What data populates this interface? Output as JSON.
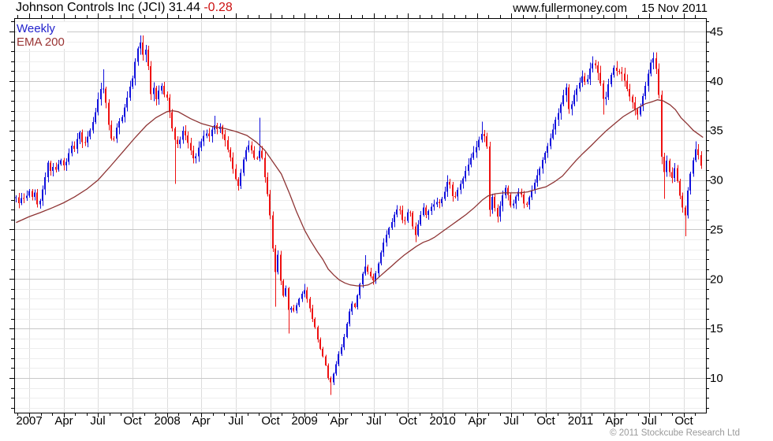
{
  "header": {
    "title": "Johnson Controls Inc (JCI) 31.44",
    "change": "-0.28",
    "website": "www.fullermoney.com",
    "date": "15 Nov 2011"
  },
  "legend": {
    "timeframe": "Weekly",
    "indicator": "EMA 200"
  },
  "footer": {
    "copyright": "© 2011 Stockcube Research Ltd"
  },
  "colors": {
    "up": "#1111dd",
    "down": "#ee1111",
    "ema": "#8e3434",
    "grid_major": "#c8c8c8",
    "grid_minor": "#ededed",
    "grid_vertical": "#dcdcdc",
    "axis": "#000000",
    "label": "#000000",
    "legend_timeframe": "#2222cc",
    "legend_indicator": "#993333",
    "change_negative": "#cc1111",
    "copyright": "#9a9a9a"
  },
  "chart_data": {
    "type": "candlestick",
    "title": "Johnson Controls Inc (JCI)",
    "interval": "weekly",
    "overlay": "EMA 200",
    "last_close": 31.44,
    "change": -0.28,
    "x_range": [
      2006.9,
      2011.885
    ],
    "ylim": [
      6.4,
      46.35
    ],
    "grid": "on",
    "y_tick_labels": [
      "10",
      "15",
      "20",
      "25",
      "30",
      "35",
      "40",
      "45"
    ],
    "y_minor_step": 1,
    "x_tick_labels": [
      "2007",
      "Apr",
      "Jul",
      "Oct",
      "2008",
      "Apr",
      "Jul",
      "Oct",
      "2009",
      "Apr",
      "Jul",
      "Oct",
      "2010",
      "Apr",
      "Jul",
      "Oct",
      "2011",
      "Apr",
      "Jul",
      "Oct"
    ],
    "weekly_close_anchors": [
      [
        2006.905,
        28.2
      ],
      [
        2006.93,
        27.6
      ],
      [
        2006.95,
        28.4
      ],
      [
        2006.97,
        28.0
      ],
      [
        2007.0,
        28.9
      ],
      [
        2007.02,
        28.2
      ],
      [
        2007.04,
        28.7
      ],
      [
        2007.06,
        27.4
      ],
      [
        2007.08,
        27.9
      ],
      [
        2007.1,
        29.2
      ],
      [
        2007.12,
        30.5
      ],
      [
        2007.14,
        32.2
      ],
      [
        2007.155,
        30.8
      ],
      [
        2007.17,
        31.5
      ],
      [
        2007.19,
        30.9
      ],
      [
        2007.21,
        31.6
      ],
      [
        2007.23,
        32.1
      ],
      [
        2007.25,
        31.4
      ],
      [
        2007.27,
        31.9
      ],
      [
        2007.29,
        32.7
      ],
      [
        2007.31,
        33.6
      ],
      [
        2007.33,
        33.1
      ],
      [
        2007.35,
        34.3
      ],
      [
        2007.37,
        35.0
      ],
      [
        2007.39,
        33.4
      ],
      [
        2007.41,
        33.9
      ],
      [
        2007.43,
        34.6
      ],
      [
        2007.45,
        35.4
      ],
      [
        2007.47,
        36.3
      ],
      [
        2007.49,
        37.4
      ],
      [
        2007.51,
        38.9
      ],
      [
        2007.53,
        39.7
      ],
      [
        2007.55,
        38.6
      ],
      [
        2007.57,
        36.4
      ],
      [
        2007.59,
        34.2
      ],
      [
        2007.61,
        33.9
      ],
      [
        2007.63,
        35.2
      ],
      [
        2007.65,
        35.8
      ],
      [
        2007.67,
        36.3
      ],
      [
        2007.69,
        37.2
      ],
      [
        2007.71,
        38.3
      ],
      [
        2007.73,
        39.4
      ],
      [
        2007.75,
        40.3
      ],
      [
        2007.77,
        42.0
      ],
      [
        2007.79,
        43.4
      ],
      [
        2007.81,
        44.0
      ],
      [
        2007.83,
        42.4
      ],
      [
        2007.85,
        43.4
      ],
      [
        2007.87,
        40.9
      ],
      [
        2007.885,
        38.5
      ],
      [
        2007.9,
        39.6
      ],
      [
        2007.92,
        38.1
      ],
      [
        2007.94,
        38.9
      ],
      [
        2007.96,
        39.6
      ],
      [
        2007.98,
        38.7
      ],
      [
        2008.0,
        38.3
      ],
      [
        2008.02,
        36.7
      ],
      [
        2008.04,
        34.9
      ],
      [
        2008.06,
        33.9
      ],
      [
        2008.08,
        33.5
      ],
      [
        2008.1,
        34.3
      ],
      [
        2008.12,
        35.2
      ],
      [
        2008.14,
        34.1
      ],
      [
        2008.16,
        33.5
      ],
      [
        2008.18,
        32.5
      ],
      [
        2008.2,
        31.9
      ],
      [
        2008.22,
        33.0
      ],
      [
        2008.24,
        33.6
      ],
      [
        2008.26,
        34.2
      ],
      [
        2008.28,
        34.8
      ],
      [
        2008.3,
        34.3
      ],
      [
        2008.32,
        35.0
      ],
      [
        2008.34,
        35.6
      ],
      [
        2008.36,
        35.1
      ],
      [
        2008.38,
        35.5
      ],
      [
        2008.4,
        34.6
      ],
      [
        2008.42,
        34.0
      ],
      [
        2008.44,
        33.1
      ],
      [
        2008.46,
        32.2
      ],
      [
        2008.48,
        31.0
      ],
      [
        2008.5,
        29.9
      ],
      [
        2008.52,
        29.4
      ],
      [
        2008.54,
        31.1
      ],
      [
        2008.56,
        32.3
      ],
      [
        2008.58,
        33.2
      ],
      [
        2008.6,
        33.6
      ],
      [
        2008.62,
        32.8
      ],
      [
        2008.64,
        31.8
      ],
      [
        2008.66,
        32.5
      ],
      [
        2008.68,
        33.4
      ],
      [
        2008.7,
        31.0
      ],
      [
        2008.72,
        29.3
      ],
      [
        2008.74,
        27.5
      ],
      [
        2008.76,
        24.8
      ],
      [
        2008.78,
        19.6
      ],
      [
        2008.8,
        23.3
      ],
      [
        2008.82,
        20.2
      ],
      [
        2008.84,
        18.1
      ],
      [
        2008.86,
        19.6
      ],
      [
        2008.875,
        16.4
      ],
      [
        2008.89,
        17.6
      ],
      [
        2008.91,
        16.6
      ],
      [
        2008.93,
        17.0
      ],
      [
        2008.95,
        17.8
      ],
      [
        2008.97,
        18.3
      ],
      [
        2009.0,
        18.9
      ],
      [
        2009.02,
        17.8
      ],
      [
        2009.04,
        16.9
      ],
      [
        2009.06,
        15.7
      ],
      [
        2009.08,
        14.8
      ],
      [
        2009.1,
        13.5
      ],
      [
        2009.12,
        12.6
      ],
      [
        2009.14,
        11.9
      ],
      [
        2009.16,
        10.7
      ],
      [
        2009.18,
        9.3
      ],
      [
        2009.2,
        9.9
      ],
      [
        2009.22,
        11.1
      ],
      [
        2009.24,
        12.1
      ],
      [
        2009.26,
        12.9
      ],
      [
        2009.28,
        13.8
      ],
      [
        2009.3,
        15.2
      ],
      [
        2009.32,
        16.6
      ],
      [
        2009.34,
        17.5
      ],
      [
        2009.36,
        17.0
      ],
      [
        2009.38,
        18.3
      ],
      [
        2009.4,
        19.4
      ],
      [
        2009.42,
        20.5
      ],
      [
        2009.44,
        21.3
      ],
      [
        2009.46,
        20.7
      ],
      [
        2009.48,
        20.1
      ],
      [
        2009.5,
        19.7
      ],
      [
        2009.52,
        20.9
      ],
      [
        2009.54,
        21.9
      ],
      [
        2009.56,
        23.1
      ],
      [
        2009.58,
        24.1
      ],
      [
        2009.6,
        24.7
      ],
      [
        2009.62,
        25.4
      ],
      [
        2009.64,
        26.1
      ],
      [
        2009.66,
        26.9
      ],
      [
        2009.68,
        27.3
      ],
      [
        2009.7,
        26.3
      ],
      [
        2009.72,
        25.5
      ],
      [
        2009.74,
        26.6
      ],
      [
        2009.76,
        27.1
      ],
      [
        2009.78,
        25.6
      ],
      [
        2009.8,
        24.3
      ],
      [
        2009.82,
        25.4
      ],
      [
        2009.84,
        26.5
      ],
      [
        2009.86,
        27.2
      ],
      [
        2009.88,
        26.5
      ],
      [
        2009.9,
        26.9
      ],
      [
        2009.92,
        27.3
      ],
      [
        2009.94,
        27.6
      ],
      [
        2009.96,
        27.9
      ],
      [
        2009.98,
        27.7
      ],
      [
        2010.0,
        28.2
      ],
      [
        2010.02,
        29.1
      ],
      [
        2010.04,
        30.1
      ],
      [
        2010.06,
        29.2
      ],
      [
        2010.08,
        27.9
      ],
      [
        2010.1,
        28.8
      ],
      [
        2010.12,
        29.3
      ],
      [
        2010.14,
        29.9
      ],
      [
        2010.16,
        30.6
      ],
      [
        2010.18,
        31.3
      ],
      [
        2010.2,
        32.1
      ],
      [
        2010.22,
        32.7
      ],
      [
        2010.24,
        33.1
      ],
      [
        2010.26,
        33.9
      ],
      [
        2010.28,
        34.8
      ],
      [
        2010.3,
        34.4
      ],
      [
        2010.32,
        33.9
      ],
      [
        2010.34,
        26.9
      ],
      [
        2010.36,
        28.3
      ],
      [
        2010.38,
        27.2
      ],
      [
        2010.4,
        26.3
      ],
      [
        2010.42,
        27.5
      ],
      [
        2010.44,
        28.7
      ],
      [
        2010.46,
        29.3
      ],
      [
        2010.48,
        28.2
      ],
      [
        2010.5,
        27.1
      ],
      [
        2010.52,
        27.9
      ],
      [
        2010.54,
        28.5
      ],
      [
        2010.56,
        29.0
      ],
      [
        2010.58,
        28.1
      ],
      [
        2010.6,
        27.1
      ],
      [
        2010.62,
        27.9
      ],
      [
        2010.64,
        28.6
      ],
      [
        2010.66,
        29.4
      ],
      [
        2010.68,
        30.3
      ],
      [
        2010.7,
        31.0
      ],
      [
        2010.72,
        31.8
      ],
      [
        2010.74,
        32.6
      ],
      [
        2010.76,
        33.3
      ],
      [
        2010.78,
        34.1
      ],
      [
        2010.8,
        35.1
      ],
      [
        2010.82,
        36.0
      ],
      [
        2010.84,
        36.8
      ],
      [
        2010.86,
        37.7
      ],
      [
        2010.88,
        38.6
      ],
      [
        2010.9,
        39.4
      ],
      [
        2010.92,
        36.6
      ],
      [
        2010.94,
        37.9
      ],
      [
        2010.96,
        38.9
      ],
      [
        2010.98,
        39.5
      ],
      [
        2011.0,
        40.1
      ],
      [
        2011.02,
        40.6
      ],
      [
        2011.04,
        39.5
      ],
      [
        2011.06,
        40.9
      ],
      [
        2011.08,
        41.6
      ],
      [
        2011.1,
        42.0
      ],
      [
        2011.12,
        41.1
      ],
      [
        2011.14,
        40.2
      ],
      [
        2011.16,
        38.7
      ],
      [
        2011.175,
        37.4
      ],
      [
        2011.19,
        38.9
      ],
      [
        2011.21,
        40.1
      ],
      [
        2011.23,
        40.9
      ],
      [
        2011.25,
        41.5
      ],
      [
        2011.27,
        40.7
      ],
      [
        2011.29,
        41.2
      ],
      [
        2011.31,
        40.4
      ],
      [
        2011.33,
        39.5
      ],
      [
        2011.35,
        38.7
      ],
      [
        2011.37,
        38.1
      ],
      [
        2011.39,
        37.4
      ],
      [
        2011.41,
        36.5
      ],
      [
        2011.43,
        37.2
      ],
      [
        2011.45,
        38.3
      ],
      [
        2011.47,
        39.3
      ],
      [
        2011.49,
        40.6
      ],
      [
        2011.51,
        41.8
      ],
      [
        2011.53,
        42.3
      ],
      [
        2011.55,
        41.2
      ],
      [
        2011.565,
        39.9
      ],
      [
        2011.585,
        33.1
      ],
      [
        2011.6,
        29.8
      ],
      [
        2011.62,
        32.4
      ],
      [
        2011.64,
        31.1
      ],
      [
        2011.66,
        29.9
      ],
      [
        2011.68,
        31.4
      ],
      [
        2011.7,
        30.1
      ],
      [
        2011.72,
        28.6
      ],
      [
        2011.74,
        27.2
      ],
      [
        2011.76,
        26.4
      ],
      [
        2011.78,
        29.0
      ],
      [
        2011.8,
        30.7
      ],
      [
        2011.82,
        32.1
      ],
      [
        2011.84,
        33.3
      ],
      [
        2011.86,
        32.4
      ],
      [
        2011.876,
        31.44
      ]
    ],
    "wick_extremes": [
      [
        2007.53,
        "high",
        41.2
      ],
      [
        2007.81,
        "high",
        44.6
      ],
      [
        2008.06,
        "low",
        29.6
      ],
      [
        2008.34,
        "high",
        36.5
      ],
      [
        2008.68,
        "high",
        36.3
      ],
      [
        2008.78,
        "low",
        17.2
      ],
      [
        2008.875,
        "low",
        14.5
      ],
      [
        2009.0,
        "high",
        19.5
      ],
      [
        2009.18,
        "low",
        8.3
      ],
      [
        2009.44,
        "high",
        22.4
      ],
      [
        2009.8,
        "low",
        23.7
      ],
      [
        2010.04,
        "high",
        30.5
      ],
      [
        2010.28,
        "high",
        35.9
      ],
      [
        2010.34,
        "low",
        26.3
      ],
      [
        2010.4,
        "low",
        25.7
      ],
      [
        2011.08,
        "high",
        42.5
      ],
      [
        2011.175,
        "low",
        36.6
      ],
      [
        2011.53,
        "high",
        42.9
      ],
      [
        2011.585,
        "low",
        31.6
      ],
      [
        2011.6,
        "low",
        28.1
      ],
      [
        2011.76,
        "low",
        24.3
      ],
      [
        2011.84,
        "high",
        33.9
      ]
    ],
    "ema200_points": [
      [
        2006.905,
        25.7
      ],
      [
        2007.0,
        26.3
      ],
      [
        2007.08,
        26.7
      ],
      [
        2007.17,
        27.2
      ],
      [
        2007.25,
        27.7
      ],
      [
        2007.33,
        28.3
      ],
      [
        2007.42,
        29.1
      ],
      [
        2007.5,
        30.0
      ],
      [
        2007.59,
        31.4
      ],
      [
        2007.69,
        33.0
      ],
      [
        2007.77,
        34.3
      ],
      [
        2007.85,
        35.5
      ],
      [
        2007.92,
        36.3
      ],
      [
        2008.0,
        36.9
      ],
      [
        2008.04,
        37.0
      ],
      [
        2008.08,
        36.9
      ],
      [
        2008.17,
        36.2
      ],
      [
        2008.25,
        35.7
      ],
      [
        2008.33,
        35.4
      ],
      [
        2008.42,
        35.2
      ],
      [
        2008.5,
        34.9
      ],
      [
        2008.58,
        34.5
      ],
      [
        2008.65,
        33.8
      ],
      [
        2008.71,
        33.0
      ],
      [
        2008.77,
        31.8
      ],
      [
        2008.83,
        30.6
      ],
      [
        2008.89,
        28.6
      ],
      [
        2008.94,
        26.8
      ],
      [
        2009.0,
        24.9
      ],
      [
        2009.04,
        23.9
      ],
      [
        2009.09,
        22.8
      ],
      [
        2009.13,
        22.0
      ],
      [
        2009.17,
        21.0
      ],
      [
        2009.21,
        20.4
      ],
      [
        2009.25,
        19.9
      ],
      [
        2009.29,
        19.6
      ],
      [
        2009.33,
        19.4
      ],
      [
        2009.38,
        19.3
      ],
      [
        2009.42,
        19.3
      ],
      [
        2009.46,
        19.4
      ],
      [
        2009.5,
        19.7
      ],
      [
        2009.54,
        20.2
      ],
      [
        2009.58,
        20.7
      ],
      [
        2009.63,
        21.3
      ],
      [
        2009.67,
        21.8
      ],
      [
        2009.72,
        22.4
      ],
      [
        2009.77,
        22.9
      ],
      [
        2009.81,
        23.3
      ],
      [
        2009.86,
        23.7
      ],
      [
        2009.9,
        23.9
      ],
      [
        2009.94,
        24.2
      ],
      [
        2010.0,
        24.8
      ],
      [
        2010.06,
        25.4
      ],
      [
        2010.12,
        26.0
      ],
      [
        2010.17,
        26.5
      ],
      [
        2010.23,
        27.2
      ],
      [
        2010.29,
        28.0
      ],
      [
        2010.33,
        28.4
      ],
      [
        2010.38,
        28.6
      ],
      [
        2010.44,
        28.7
      ],
      [
        2010.5,
        28.7
      ],
      [
        2010.56,
        28.7
      ],
      [
        2010.62,
        28.8
      ],
      [
        2010.69,
        29.1
      ],
      [
        2010.75,
        29.3
      ],
      [
        2010.81,
        29.8
      ],
      [
        2010.87,
        30.4
      ],
      [
        2010.92,
        31.2
      ],
      [
        2010.97,
        32.0
      ],
      [
        2011.02,
        32.7
      ],
      [
        2011.08,
        33.5
      ],
      [
        2011.13,
        34.2
      ],
      [
        2011.19,
        35.0
      ],
      [
        2011.25,
        35.7
      ],
      [
        2011.31,
        36.4
      ],
      [
        2011.37,
        36.9
      ],
      [
        2011.42,
        37.3
      ],
      [
        2011.47,
        37.7
      ],
      [
        2011.52,
        37.9
      ],
      [
        2011.56,
        38.1
      ],
      [
        2011.6,
        38.0
      ],
      [
        2011.65,
        37.6
      ],
      [
        2011.69,
        37.1
      ],
      [
        2011.73,
        36.3
      ],
      [
        2011.78,
        35.6
      ],
      [
        2011.82,
        35.0
      ],
      [
        2011.86,
        34.6
      ],
      [
        2011.89,
        34.3
      ]
    ]
  }
}
